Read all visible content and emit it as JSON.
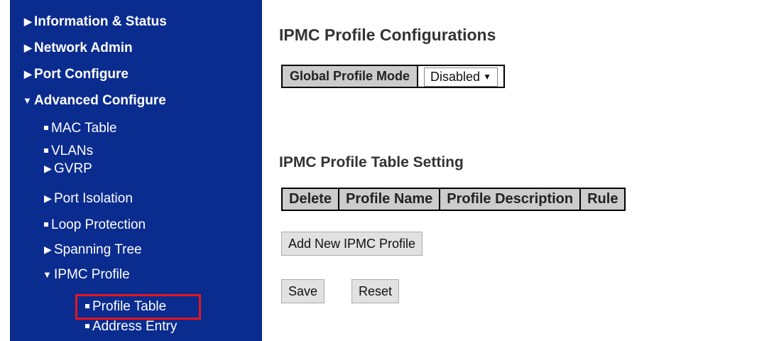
{
  "sidebar": {
    "items": [
      {
        "label": "Information & Status"
      },
      {
        "label": "Network Admin"
      },
      {
        "label": "Port Configure"
      },
      {
        "label": "Advanced Configure"
      },
      {
        "label": "MAC Table"
      },
      {
        "label": "VLANs"
      },
      {
        "label": "GVRP"
      },
      {
        "label": "Port Isolation"
      },
      {
        "label": "Loop Protection"
      },
      {
        "label": "Spanning Tree"
      },
      {
        "label": "IPMC Profile"
      },
      {
        "label": "Profile Table"
      },
      {
        "label": "Address Entry"
      }
    ]
  },
  "main": {
    "title": "IPMC Profile Configurations",
    "global_mode": {
      "label": "Global Profile Mode",
      "value": "Disabled"
    },
    "table_title": "IPMC Profile Table Setting",
    "table_headers": [
      "Delete",
      "Profile Name",
      "Profile Description",
      "Rule"
    ],
    "add_button": "Add New IPMC Profile",
    "save_button": "Save",
    "reset_button": "Reset"
  },
  "colors": {
    "sidebar_bg": "#0b2c8f",
    "highlight": "#e8141c",
    "header_bg": "#cccccc"
  }
}
